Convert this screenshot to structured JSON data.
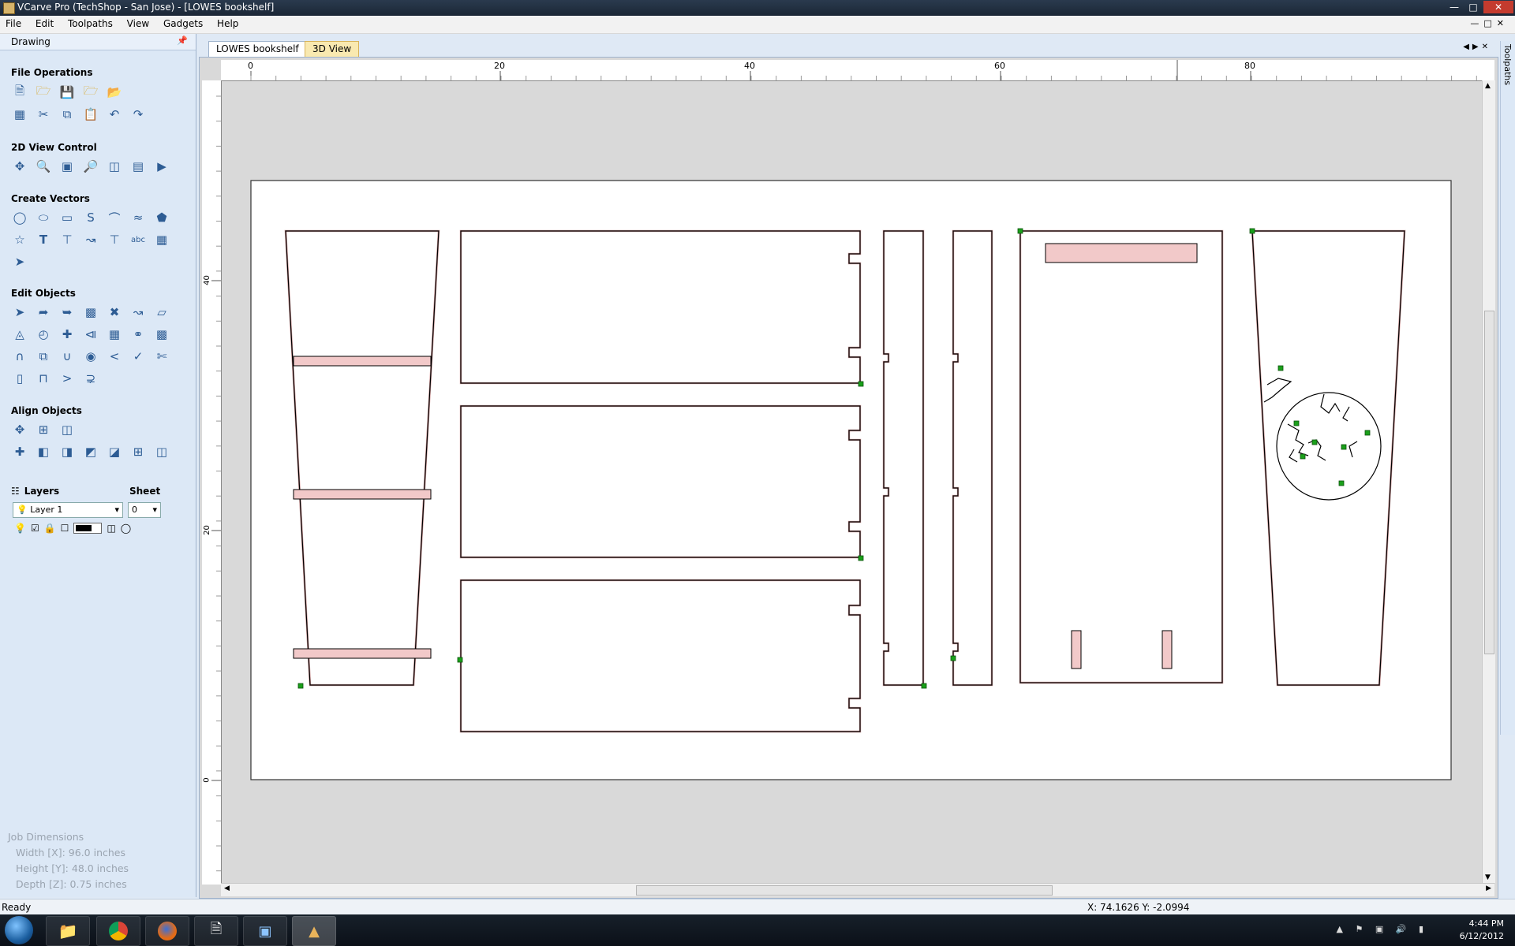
{
  "window": {
    "title": "VCarve Pro (TechShop - San Jose) - [LOWES bookshelf]"
  },
  "menu": [
    "File",
    "Edit",
    "Toolpaths",
    "View",
    "Gadgets",
    "Help"
  ],
  "left_panel": {
    "title": "Drawing",
    "sections": {
      "file_ops": "File Operations",
      "view_ctrl": "2D View Control",
      "create_vectors": "Create Vectors",
      "edit_objects": "Edit Objects",
      "align_objects": "Align Objects"
    },
    "layers": {
      "label": "Layers",
      "sheet_label": "Sheet",
      "layer_value": "Layer 1",
      "sheet_value": "0"
    },
    "job_dimensions": {
      "title": "Job Dimensions",
      "width": "Width  [X]: 96.0 inches",
      "height": "Height [Y]: 48.0 inches",
      "depth": "Depth  [Z]: 0.75 inches"
    }
  },
  "tabs": [
    "LOWES bookshelf",
    "3D View"
  ],
  "side_tab": "Toolpaths",
  "rulers": {
    "top": [
      "0",
      "20",
      "40",
      "60",
      "80"
    ],
    "left": [
      "40",
      "20",
      "0"
    ]
  },
  "status": {
    "left": "Ready",
    "coords": "X: 74.1626 Y: -2.0994"
  },
  "taskbar": {
    "time": "4:44 PM",
    "date": "6/12/2012"
  },
  "colors": {
    "accent_tab": "#f9e9b0",
    "part_outline": "#000000",
    "pocket_fill": "#f2c9c9",
    "node": "#1aa01a"
  }
}
